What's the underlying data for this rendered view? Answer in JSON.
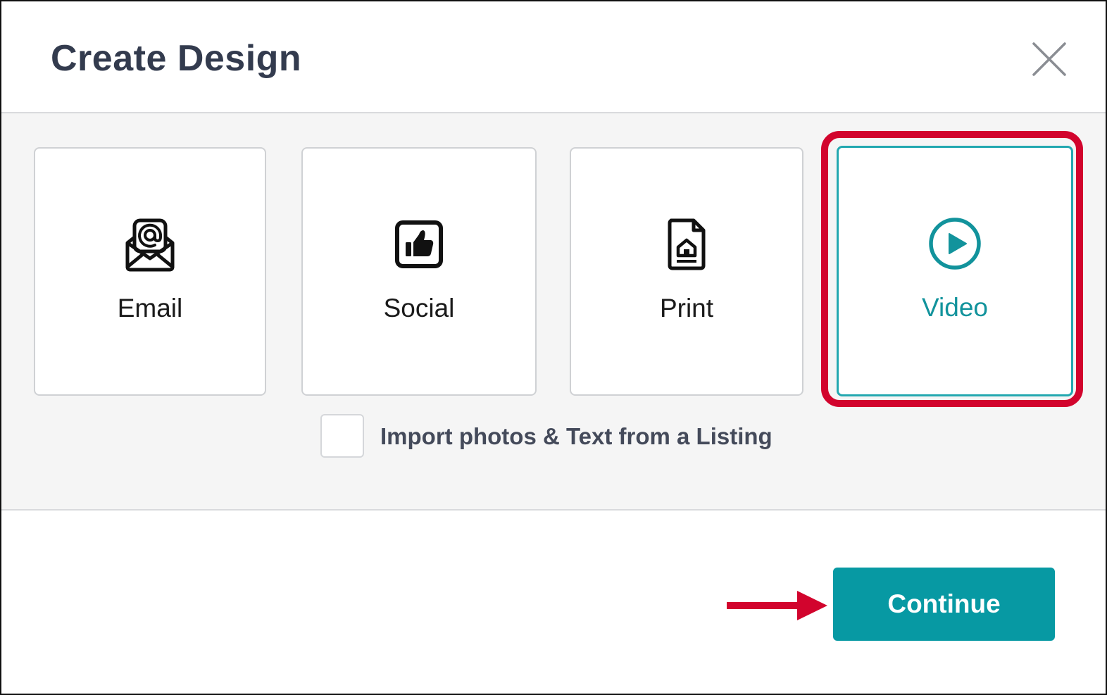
{
  "dialog": {
    "title": "Create Design",
    "close_icon": "close-icon"
  },
  "options": [
    {
      "label": "Email",
      "icon": "email-icon",
      "selected": false
    },
    {
      "label": "Social",
      "icon": "thumbs-up-icon",
      "selected": false
    },
    {
      "label": "Print",
      "icon": "print-document-icon",
      "selected": false
    },
    {
      "label": "Video",
      "icon": "play-circle-icon",
      "selected": true
    }
  ],
  "import_option": {
    "label": "Import photos & Text from a Listing",
    "checked": false
  },
  "footer": {
    "continue_label": "Continue"
  },
  "annotations": {
    "highlight_color": "#d2042d",
    "arrow_icon": "arrow-right-icon"
  },
  "colors": {
    "accent": "#0799a3",
    "selected_border": "#23a8b0",
    "title": "#333b4e"
  }
}
